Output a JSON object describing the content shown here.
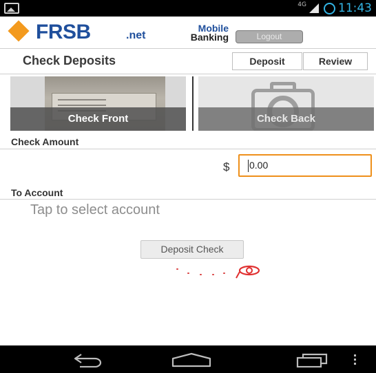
{
  "status_bar": {
    "network": "4G",
    "time": "11:43"
  },
  "header": {
    "logo_name": "FRSB",
    "logo_suffix": ".net",
    "mobile_line1": "Mobile",
    "mobile_line2": "Banking",
    "logout_label": "Logout"
  },
  "page": {
    "title": "Check Deposits",
    "tabs": [
      {
        "label": "Deposit"
      },
      {
        "label": "Review"
      }
    ]
  },
  "images": {
    "front_label": "Check Front",
    "back_label": "Check Back"
  },
  "amount": {
    "section_label": "Check Amount",
    "currency_symbol": "$",
    "value": "0.00"
  },
  "account": {
    "section_label": "To Account",
    "placeholder": "Tap to select account"
  },
  "actions": {
    "deposit_label": "Deposit Check"
  },
  "colors": {
    "brand_blue": "#1f4f9c",
    "brand_orange": "#f39a1e",
    "focus_orange": "#ee8f1a",
    "status_blue": "#33b5e5"
  }
}
